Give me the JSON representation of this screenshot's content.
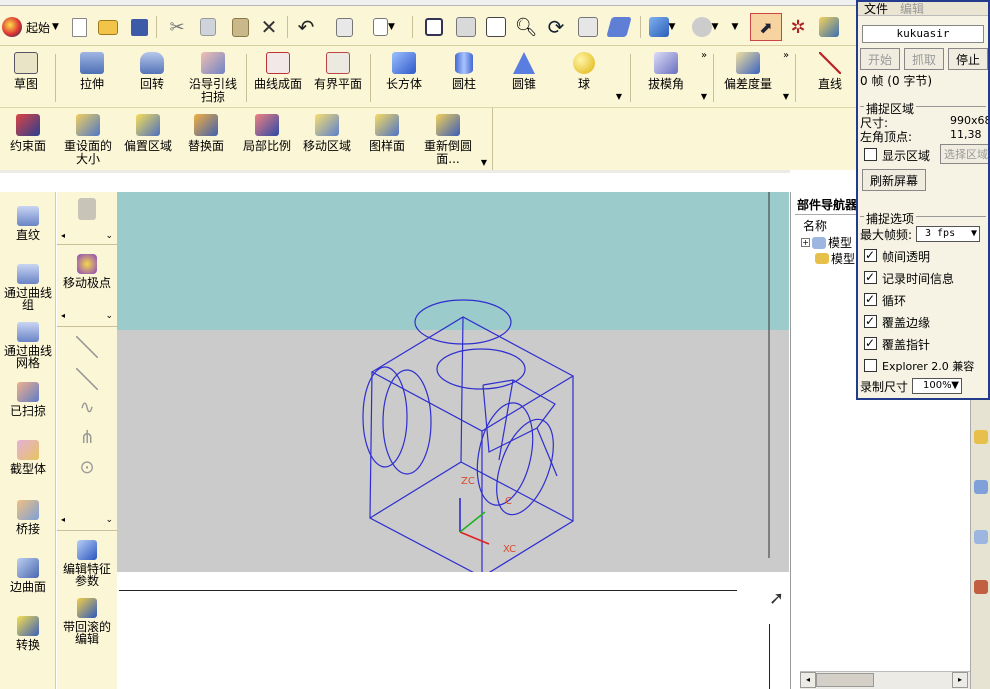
{
  "toolbar": {
    "start_label": "起始"
  },
  "ribbon1": [
    {
      "label": "草图",
      "icon": "sketch-icon"
    },
    {
      "label": "拉伸",
      "icon": "extrude-icon"
    },
    {
      "label": "回转",
      "icon": "revolve-icon"
    },
    {
      "label": "沿导引线\n扫掠",
      "icon": "sweep-along-guide-icon"
    },
    {
      "label": "曲线成面",
      "icon": "curve-to-face-icon"
    },
    {
      "label": "有界平面",
      "icon": "bounded-plane-icon"
    },
    {
      "label": "长方体",
      "icon": "block-icon"
    },
    {
      "label": "圆柱",
      "icon": "cylinder-icon"
    },
    {
      "label": "圆锥",
      "icon": "cone-icon"
    },
    {
      "label": "球",
      "icon": "sphere-icon"
    },
    {
      "label": "拔模角",
      "icon": "draft-angle-icon"
    },
    {
      "label": "偏差度量",
      "icon": "deviation-gauge-icon"
    },
    {
      "label": "直线",
      "icon": "line-icon"
    }
  ],
  "ribbon2": [
    {
      "label": "约束面",
      "icon": "constrain-face-icon"
    },
    {
      "label": "重设面的\n大小",
      "icon": "resize-face-icon"
    },
    {
      "label": "偏置区域",
      "icon": "offset-region-icon"
    },
    {
      "label": "替换面",
      "icon": "replace-face-icon"
    },
    {
      "label": "局部比例",
      "icon": "local-scale-icon"
    },
    {
      "label": "移动区域",
      "icon": "move-region-icon"
    },
    {
      "label": "图样面",
      "icon": "pattern-face-icon"
    },
    {
      "label": "重新倒圆\n面...",
      "icon": "reblend-face-icon"
    }
  ],
  "left_palette": [
    {
      "label": "直纹",
      "icon": "ruled-icon"
    },
    {
      "label": "通过曲线\n组",
      "icon": "through-curves-icon"
    },
    {
      "label": "通过曲线\n网格",
      "icon": "through-curve-mesh-icon"
    },
    {
      "label": "已扫掠",
      "icon": "swept-icon"
    },
    {
      "label": "截型体",
      "icon": "section-body-icon"
    },
    {
      "label": "桥接",
      "icon": "bridge-icon"
    },
    {
      "label": "边曲面",
      "icon": "edge-surface-icon"
    },
    {
      "label": "转换",
      "icon": "convert-icon"
    }
  ],
  "mid_palette": {
    "move_pole_label": "移动极点",
    "edit_feature_label": "编辑特征\n参数",
    "edit_rollback_label": "带回滚的\n编辑"
  },
  "viewport": {
    "zc_label": "ZC",
    "xc_label": "XC",
    "c_label": "C"
  },
  "part_navigator": {
    "title": "部件导航器",
    "name_header": "名称",
    "row1": "模型",
    "row2": "模型"
  },
  "capture_panel": {
    "menu_file": "文件",
    "menu_edit": "编辑",
    "app_name": "kukuasir",
    "start_button": "开始",
    "grab_button": "抓取",
    "stop_button": "停止",
    "frames_text": "0 帧 (0 字节)",
    "capture_region_label": "捕捉区域",
    "size_label": "尺寸:",
    "size_value": "990x689",
    "corner_label": "左角顶点:",
    "corner_value": "11,38",
    "show_region_label": "显示区域",
    "select_region_button": "选择区域",
    "refresh_button": "刷新屏幕",
    "capture_options_label": "捕捉选项",
    "max_fps_label": "最大帧频:",
    "max_fps_value": "3 fps",
    "opt_transparent": "帧间透明",
    "opt_record_time": "记录时间信息",
    "opt_loop": "循环",
    "opt_cover_edge": "覆盖边缘",
    "opt_cover_cursor": "覆盖指针",
    "opt_explorer": "Explorer 2.0 兼容",
    "record_size_label": "录制尺寸",
    "record_size_value": "100%"
  },
  "colors": {
    "wire": "#2e2ed0",
    "ribbon_bg": "#fbf6d6",
    "sky": "#9ccbcb",
    "floor": "#cbcbcb",
    "panel_border": "#223b8a"
  }
}
